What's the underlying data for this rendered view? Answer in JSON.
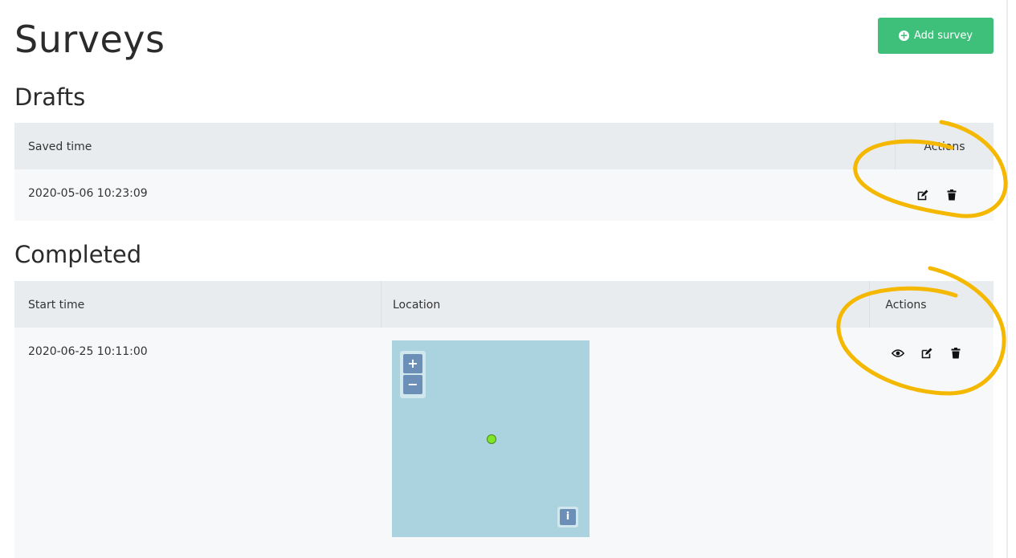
{
  "page": {
    "title": "Surveys"
  },
  "toolbar": {
    "add_label": "Add survey",
    "add_icon": "plus-circle-icon"
  },
  "colors": {
    "accent": "#3ec07a",
    "header_bg": "#e9ecef",
    "annotation": "#f5b800",
    "map_water": "#aad3df",
    "map_control": "#6b8fb7",
    "marker": "#7fe52a"
  },
  "drafts": {
    "title": "Drafts",
    "columns": [
      "Saved time",
      "Actions"
    ],
    "rows": [
      {
        "saved_time": "2020-05-06 10:23:09",
        "actions": [
          "edit-icon",
          "trash-icon"
        ]
      }
    ]
  },
  "completed": {
    "title": "Completed",
    "columns": [
      "Start time",
      "Location",
      "Actions"
    ],
    "rows": [
      {
        "start_time": "2020-06-25 10:11:00",
        "actions": [
          "eye-icon",
          "edit-icon",
          "trash-icon"
        ]
      }
    ]
  },
  "map": {
    "zoom_in": "+",
    "zoom_out": "−",
    "info": "i"
  }
}
